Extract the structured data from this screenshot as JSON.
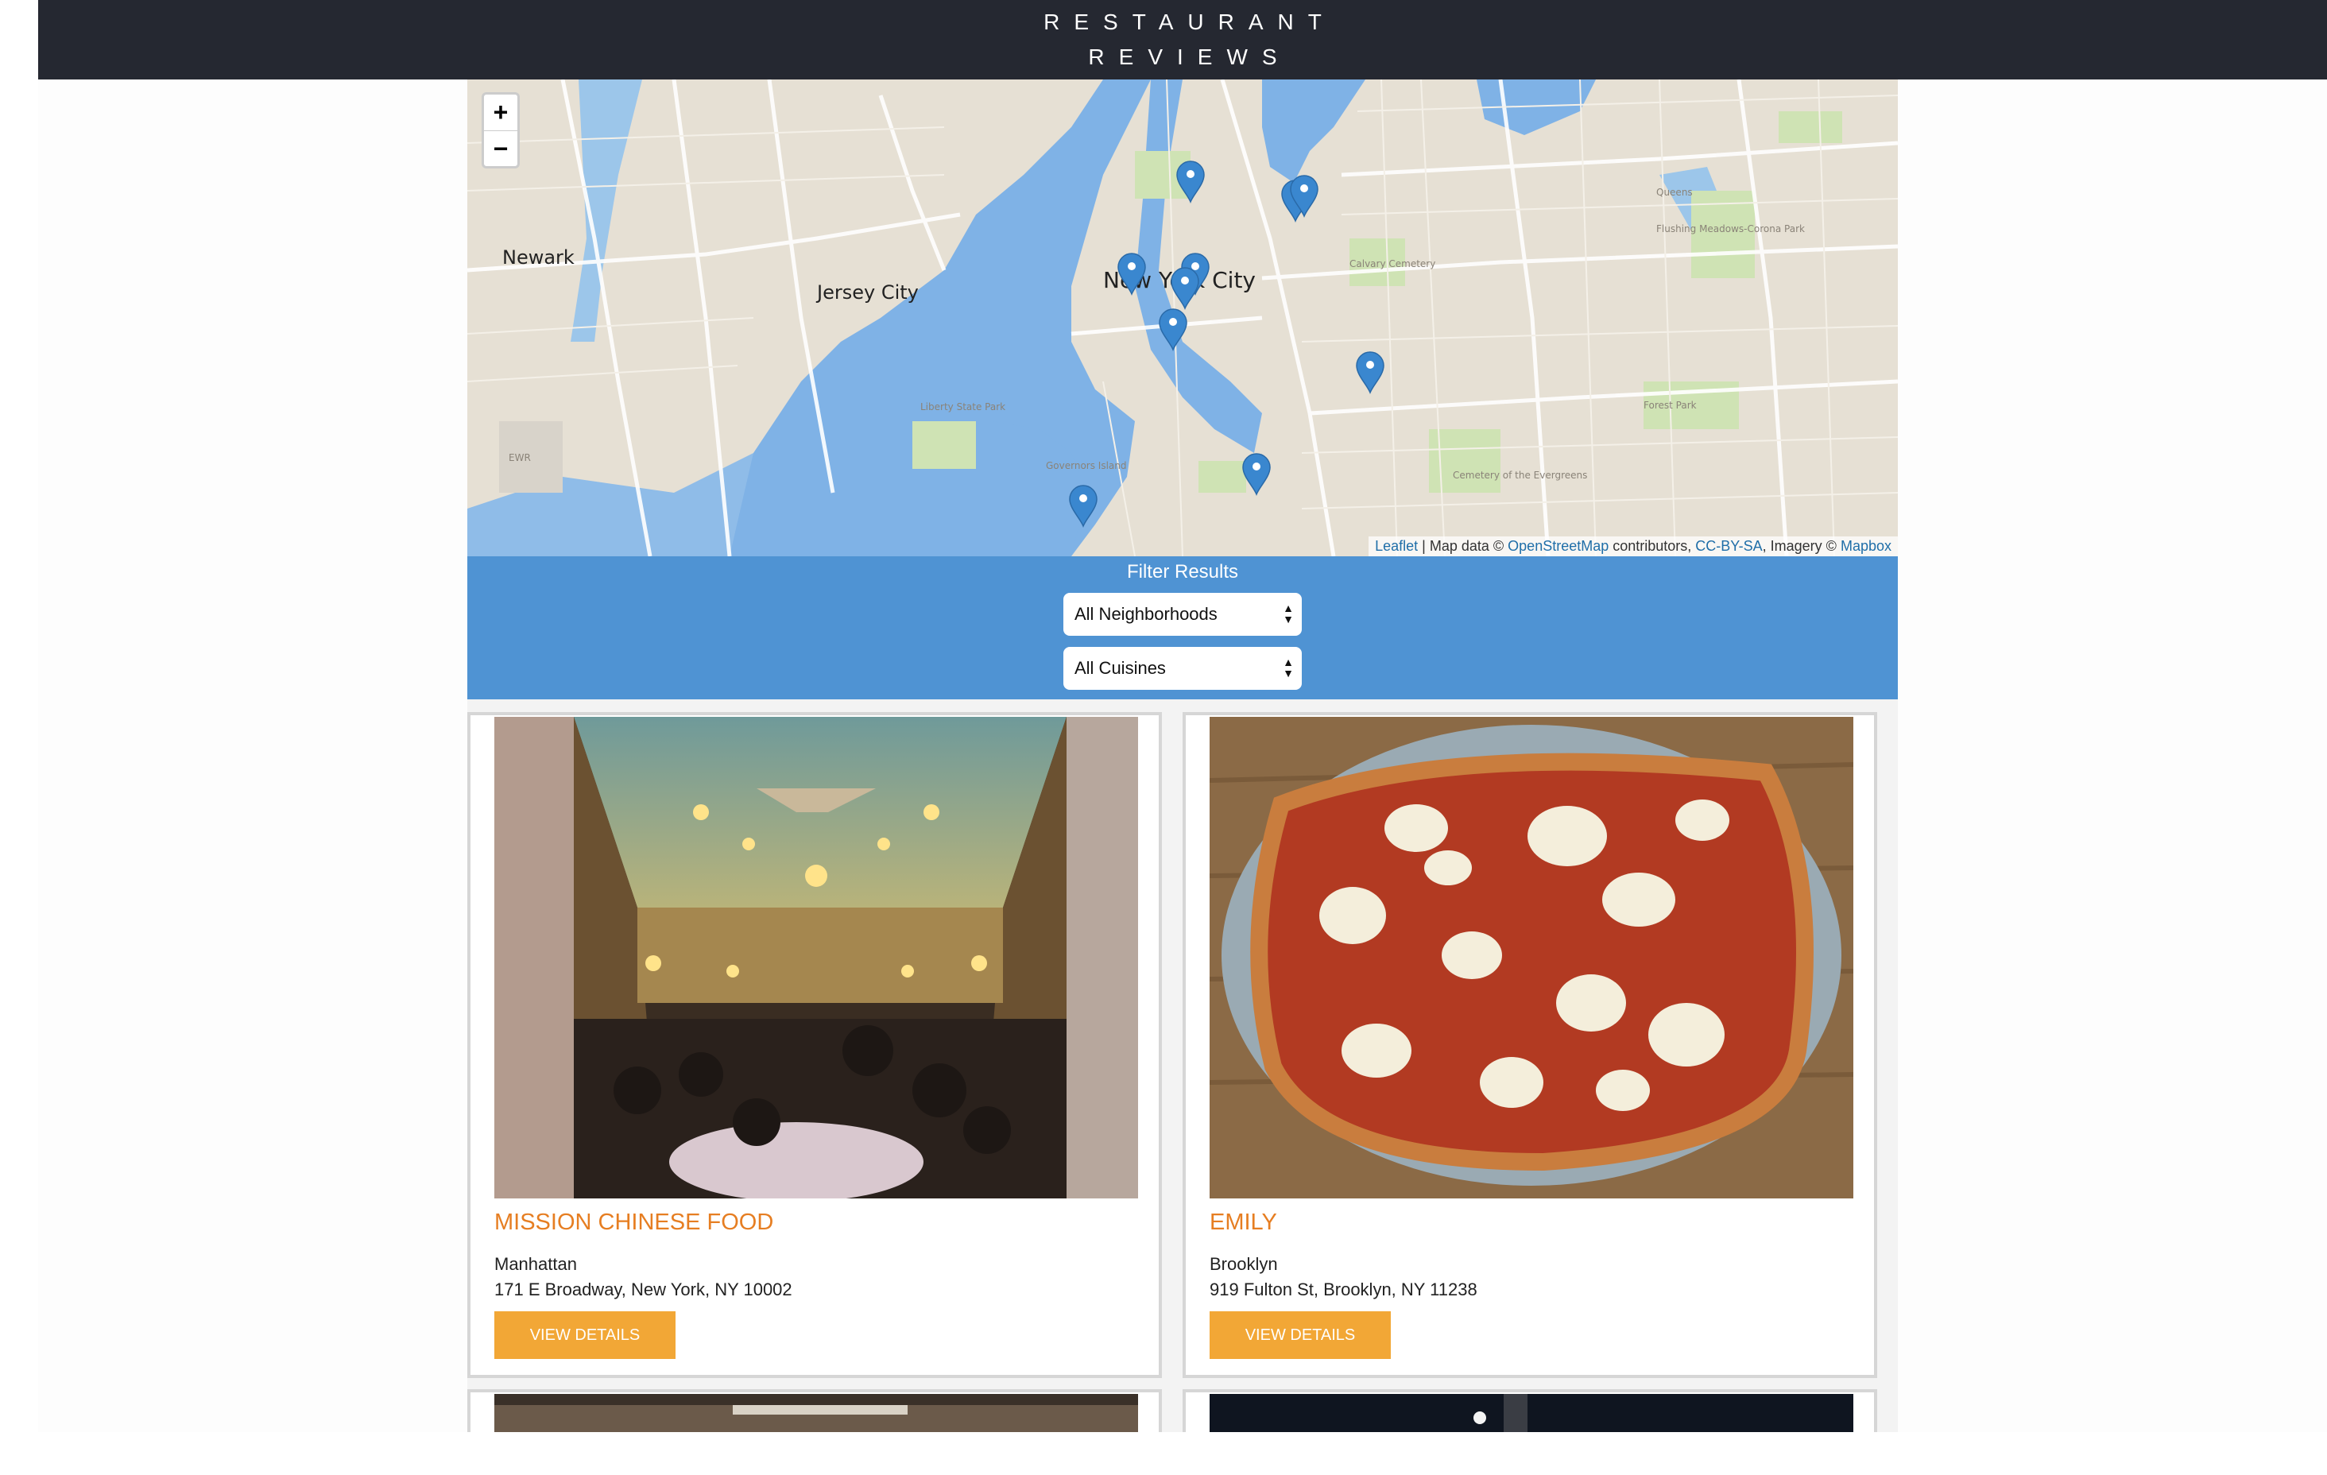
{
  "header": {
    "title_line1": "RESTAURANT",
    "title_line2": "REVIEWS"
  },
  "map": {
    "zoom_in": "+",
    "zoom_out": "−",
    "place_labels": [
      "Newark",
      "Jersey City",
      "New York City",
      "Queens",
      "Flushing Meadows-Corona Park",
      "Calvary Cemetery",
      "Liberty State Park",
      "Governors Island",
      "Forest Park",
      "Cemetery of the Evergreens",
      "EWR"
    ],
    "attribution": {
      "leaflet": "Leaflet",
      "map_data": " | Map data © ",
      "osm": "OpenStreetMap",
      "contributors": " contributors, ",
      "license": "CC-BY-SA",
      "imagery": ", Imagery © ",
      "mapbox": "Mapbox"
    }
  },
  "filter": {
    "title": "Filter Results",
    "neighborhood": "All Neighborhoods",
    "cuisine": "All Cuisines"
  },
  "restaurants": [
    {
      "name": "MISSION CHINESE FOOD",
      "neighborhood": "Manhattan",
      "address": "171 E Broadway, New York, NY 10002",
      "button": "VIEW DETAILS"
    },
    {
      "name": "EMILY",
      "neighborhood": "Brooklyn",
      "address": "919 Fulton St, Brooklyn, NY 11238",
      "button": "VIEW DETAILS"
    }
  ],
  "colors": {
    "header_bg": "#252831",
    "filter_bg": "#4f93d3",
    "accent": "#e67e22",
    "button_bg": "#f2a736",
    "marker": "#3a87cf"
  }
}
